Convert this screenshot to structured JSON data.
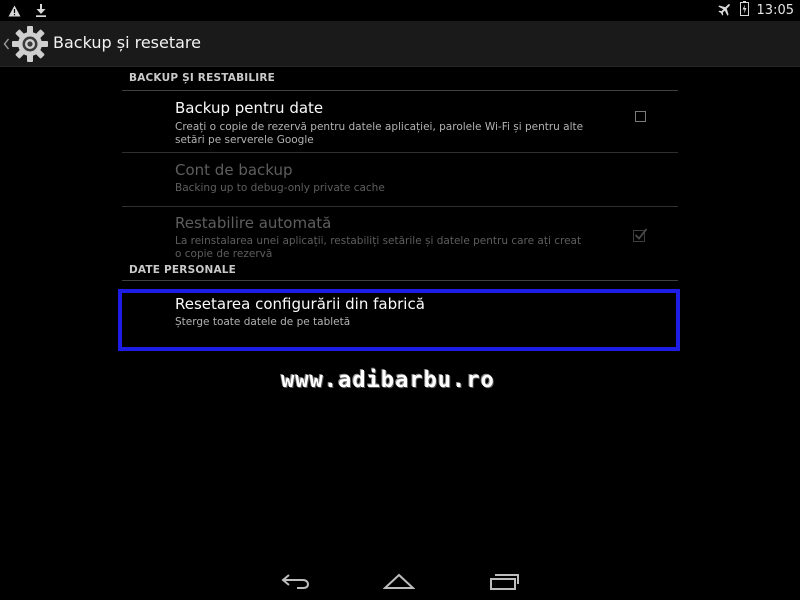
{
  "statusbar": {
    "time": "13:05",
    "left_icons": [
      "warning-icon",
      "download-icon"
    ],
    "right_icons": [
      "airplane-mode-icon",
      "battery-charging-icon"
    ]
  },
  "actionbar": {
    "title": "Backup și resetare",
    "icon": "settings-gear-icon"
  },
  "sections": {
    "backup": {
      "header": "BACKUP ȘI RESTABILIRE",
      "items": [
        {
          "title": "Backup pentru date",
          "summary": "Creați o copie de rezervă pentru datele aplicației, parolele Wi-Fi și pentru alte setări pe serverele Google",
          "checked": false,
          "enabled": true
        },
        {
          "title": "Cont de backup",
          "summary": "Backing up to debug-only private cache",
          "enabled": false
        },
        {
          "title": "Restabilire automată",
          "summary": "La reinstalarea unei aplicații, restabiliți setările și datele pentru care ați creat o copie de rezervă",
          "checked": true,
          "enabled": false
        }
      ]
    },
    "personal": {
      "header": "DATE PERSONALE",
      "items": [
        {
          "title": "Resetarea configurării din fabrică",
          "summary": "Șterge toate datele de pe tabletă",
          "enabled": true
        }
      ]
    }
  },
  "highlight_color": "#1d1de6",
  "watermark": "www.adibarbu.ro",
  "navbar": {
    "buttons": [
      "back-icon",
      "home-icon",
      "recent-apps-icon"
    ]
  }
}
